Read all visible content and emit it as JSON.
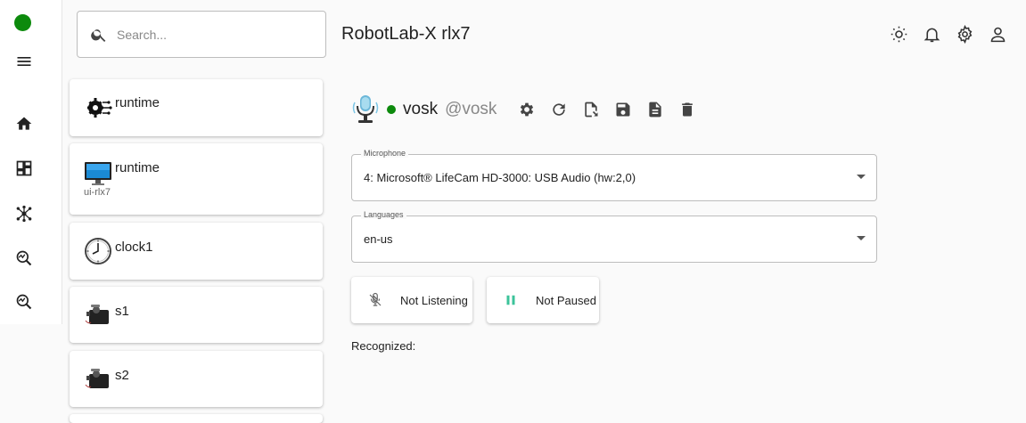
{
  "header": {
    "search_placeholder": "Search...",
    "title": "RobotLab-X rlx7"
  },
  "rail": {
    "status_color": "#0c8a0c",
    "items": [
      "menu-icon",
      "home-icon",
      "dashboard-icon",
      "network-icon",
      "search-analytics-icon",
      "search-analytics-icon"
    ]
  },
  "services": [
    {
      "name": "runtime",
      "sub": "",
      "icon": "gear-circuit-icon"
    },
    {
      "name": "runtime",
      "sub": "ui-rlx7",
      "icon": "monitor-icon"
    },
    {
      "name": "clock1",
      "sub": "",
      "icon": "clock-icon"
    },
    {
      "name": "s1",
      "sub": "",
      "icon": "servo-icon"
    },
    {
      "name": "s2",
      "sub": "",
      "icon": "servo-icon"
    }
  ],
  "detail": {
    "service_name": "vosk",
    "service_type": "@vosk",
    "status_color": "#0c8a0c",
    "microphone": {
      "label": "Microphone",
      "value": "4: Microsoft® LifeCam HD-3000: USB Audio (hw:2,0)"
    },
    "languages": {
      "label": "Languages",
      "value": "en-us"
    },
    "listen_button": "Not Listening",
    "pause_button": "Not Paused",
    "recognized_label": "Recognized:"
  }
}
